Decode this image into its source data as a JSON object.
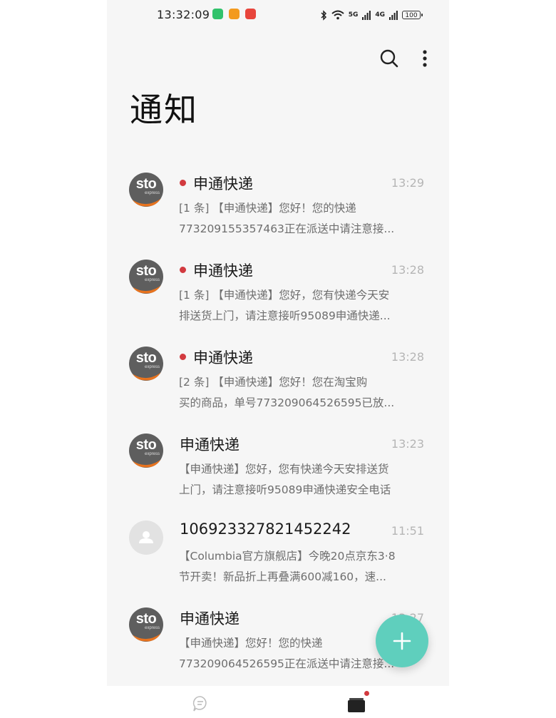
{
  "status_bar": {
    "time": "13:32:09",
    "signal_1": "5G",
    "signal_2": "4G",
    "battery": "100",
    "app_icon_colors": [
      "#31c26b",
      "#f39a1e",
      "#e8453c"
    ]
  },
  "header": {
    "title": "通知",
    "search_icon": "search-icon",
    "more_icon": "more-vertical-icon"
  },
  "messages": [
    {
      "sender": "申通快递",
      "time": "13:29",
      "unread": true,
      "avatar": "sto-logo",
      "line1": "[1 条] 【申通快递】您好！您的快递",
      "line2": "773209155357463正在派送中请注意接..."
    },
    {
      "sender": "申通快递",
      "time": "13:28",
      "unread": true,
      "avatar": "sto-logo",
      "line1": "[1 条] 【申通快递】您好，您有快递今天安",
      "line2": "排送货上门，请注意接听95089申通快递..."
    },
    {
      "sender": "申通快递",
      "time": "13:28",
      "unread": true,
      "avatar": "sto-logo",
      "line1": "[2 条] 【申通快递】您好！您在淘宝购",
      "line2": "买的商品，单号773209064526595已放..."
    },
    {
      "sender": "申通快递",
      "time": "13:23",
      "unread": false,
      "avatar": "sto-logo",
      "line1": "【申通快递】您好，您有快递今天安排送货",
      "line2": "上门，请注意接听95089申通快递安全电话"
    },
    {
      "sender": "106923327821452242",
      "time": "11:51",
      "unread": false,
      "avatar": "person",
      "line1": "【Columbia官方旗舰店】今晚20点京东3·8",
      "line2": "节开卖！新品折上再叠满600减160，速..."
    },
    {
      "sender": "申通快递",
      "time": "13:27",
      "unread": false,
      "avatar": "sto-logo",
      "line1": "【申通快递】您好！您的快递",
      "line2": "773209064526595正在派送中请注意接..."
    }
  ],
  "avatar_text": {
    "brand": "sto",
    "sub": "express"
  },
  "fab": {
    "icon": "plus-icon",
    "color": "#5fcfbd"
  },
  "bottom_nav": {
    "tabs": [
      {
        "icon": "chat-bubble-icon",
        "active": false
      },
      {
        "icon": "notification-box-icon",
        "active": true,
        "badge": true
      }
    ]
  },
  "colors": {
    "unread_dot": "#d23a3f",
    "background": "#f6f6f6",
    "sto_orange": "#e8731e"
  }
}
